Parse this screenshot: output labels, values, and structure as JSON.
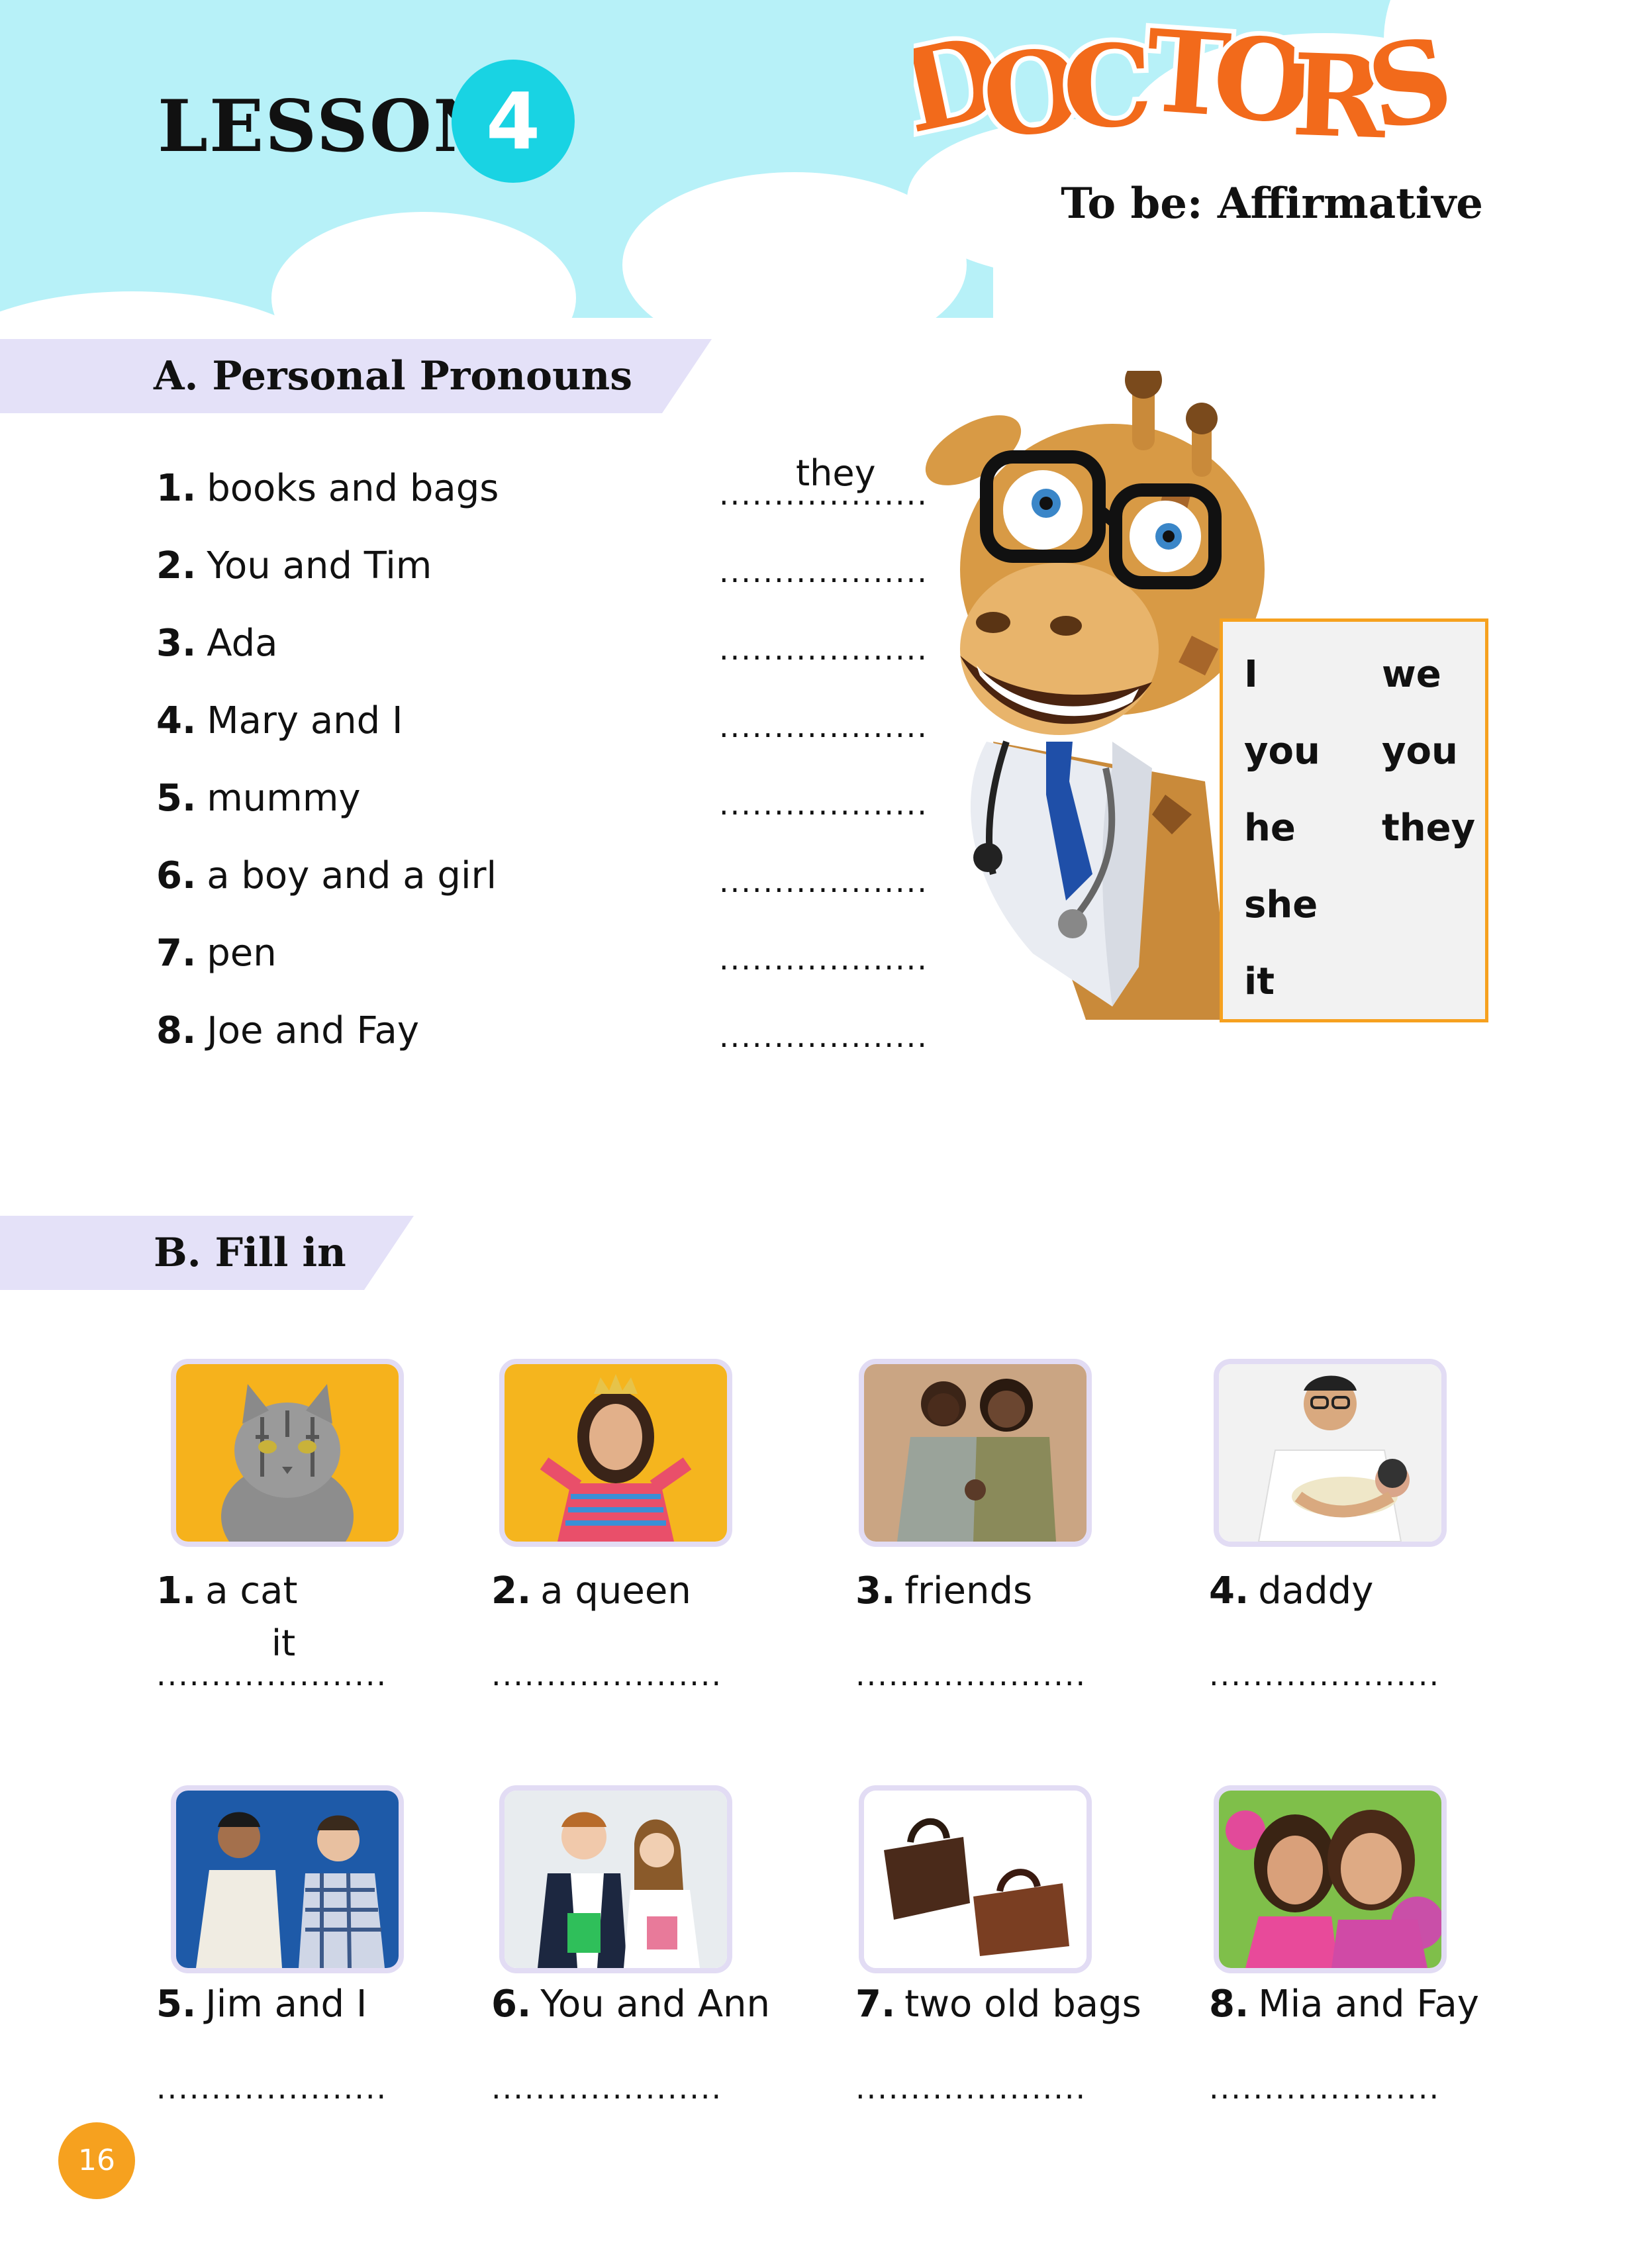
{
  "header": {
    "lesson_word": "LESSON",
    "lesson_number": "4",
    "title": "DOCTORS",
    "subtitle": "To be: Affirmative"
  },
  "section_a": {
    "title": "A. Personal Pronouns",
    "items": [
      {
        "num": "1.",
        "text": "books and bags",
        "answer": "they"
      },
      {
        "num": "2.",
        "text": "You and Tim",
        "answer": ""
      },
      {
        "num": "3.",
        "text": "Ada",
        "answer": ""
      },
      {
        "num": "4.",
        "text": "Mary and I",
        "answer": ""
      },
      {
        "num": "5.",
        "text": "mummy",
        "answer": ""
      },
      {
        "num": "6.",
        "text": "a boy and a girl",
        "answer": ""
      },
      {
        "num": "7.",
        "text": "pen",
        "answer": ""
      },
      {
        "num": "8.",
        "text": "Joe and Fay",
        "answer": ""
      }
    ],
    "blank": "...................",
    "pronouns_left": [
      "I",
      "you",
      "he",
      "she",
      "it"
    ],
    "pronouns_right": [
      "we",
      "you",
      "they"
    ]
  },
  "section_b": {
    "title": "B. Fill in",
    "blank": ".....................",
    "items": [
      {
        "num": "1.",
        "text": "a cat",
        "answer": "it",
        "image": "cat-photo"
      },
      {
        "num": "2.",
        "text": "a queen",
        "answer": "",
        "image": "queen-photo"
      },
      {
        "num": "3.",
        "text": "friends",
        "answer": "",
        "image": "friends-photo"
      },
      {
        "num": "4.",
        "text": "daddy",
        "answer": "",
        "image": "daddy-photo"
      },
      {
        "num": "5.",
        "text": "Jim and I",
        "answer": "",
        "image": "two-men-photo"
      },
      {
        "num": "6.",
        "text": "You and Ann",
        "answer": "",
        "image": "students-photo"
      },
      {
        "num": "7.",
        "text": "two old bags",
        "answer": "",
        "image": "bags-photo"
      },
      {
        "num": "8.",
        "text": "Mia and Fay",
        "answer": "",
        "image": "girls-photo"
      }
    ]
  },
  "footer": {
    "page_number": "16"
  },
  "colors": {
    "sky": "#b7f1f8",
    "badge": "#19d3e3",
    "title_orange": "#f26a1b",
    "section_bar": "#e4e1f8",
    "box_border": "#f6a11f",
    "page_badge": "#f6a11f"
  }
}
